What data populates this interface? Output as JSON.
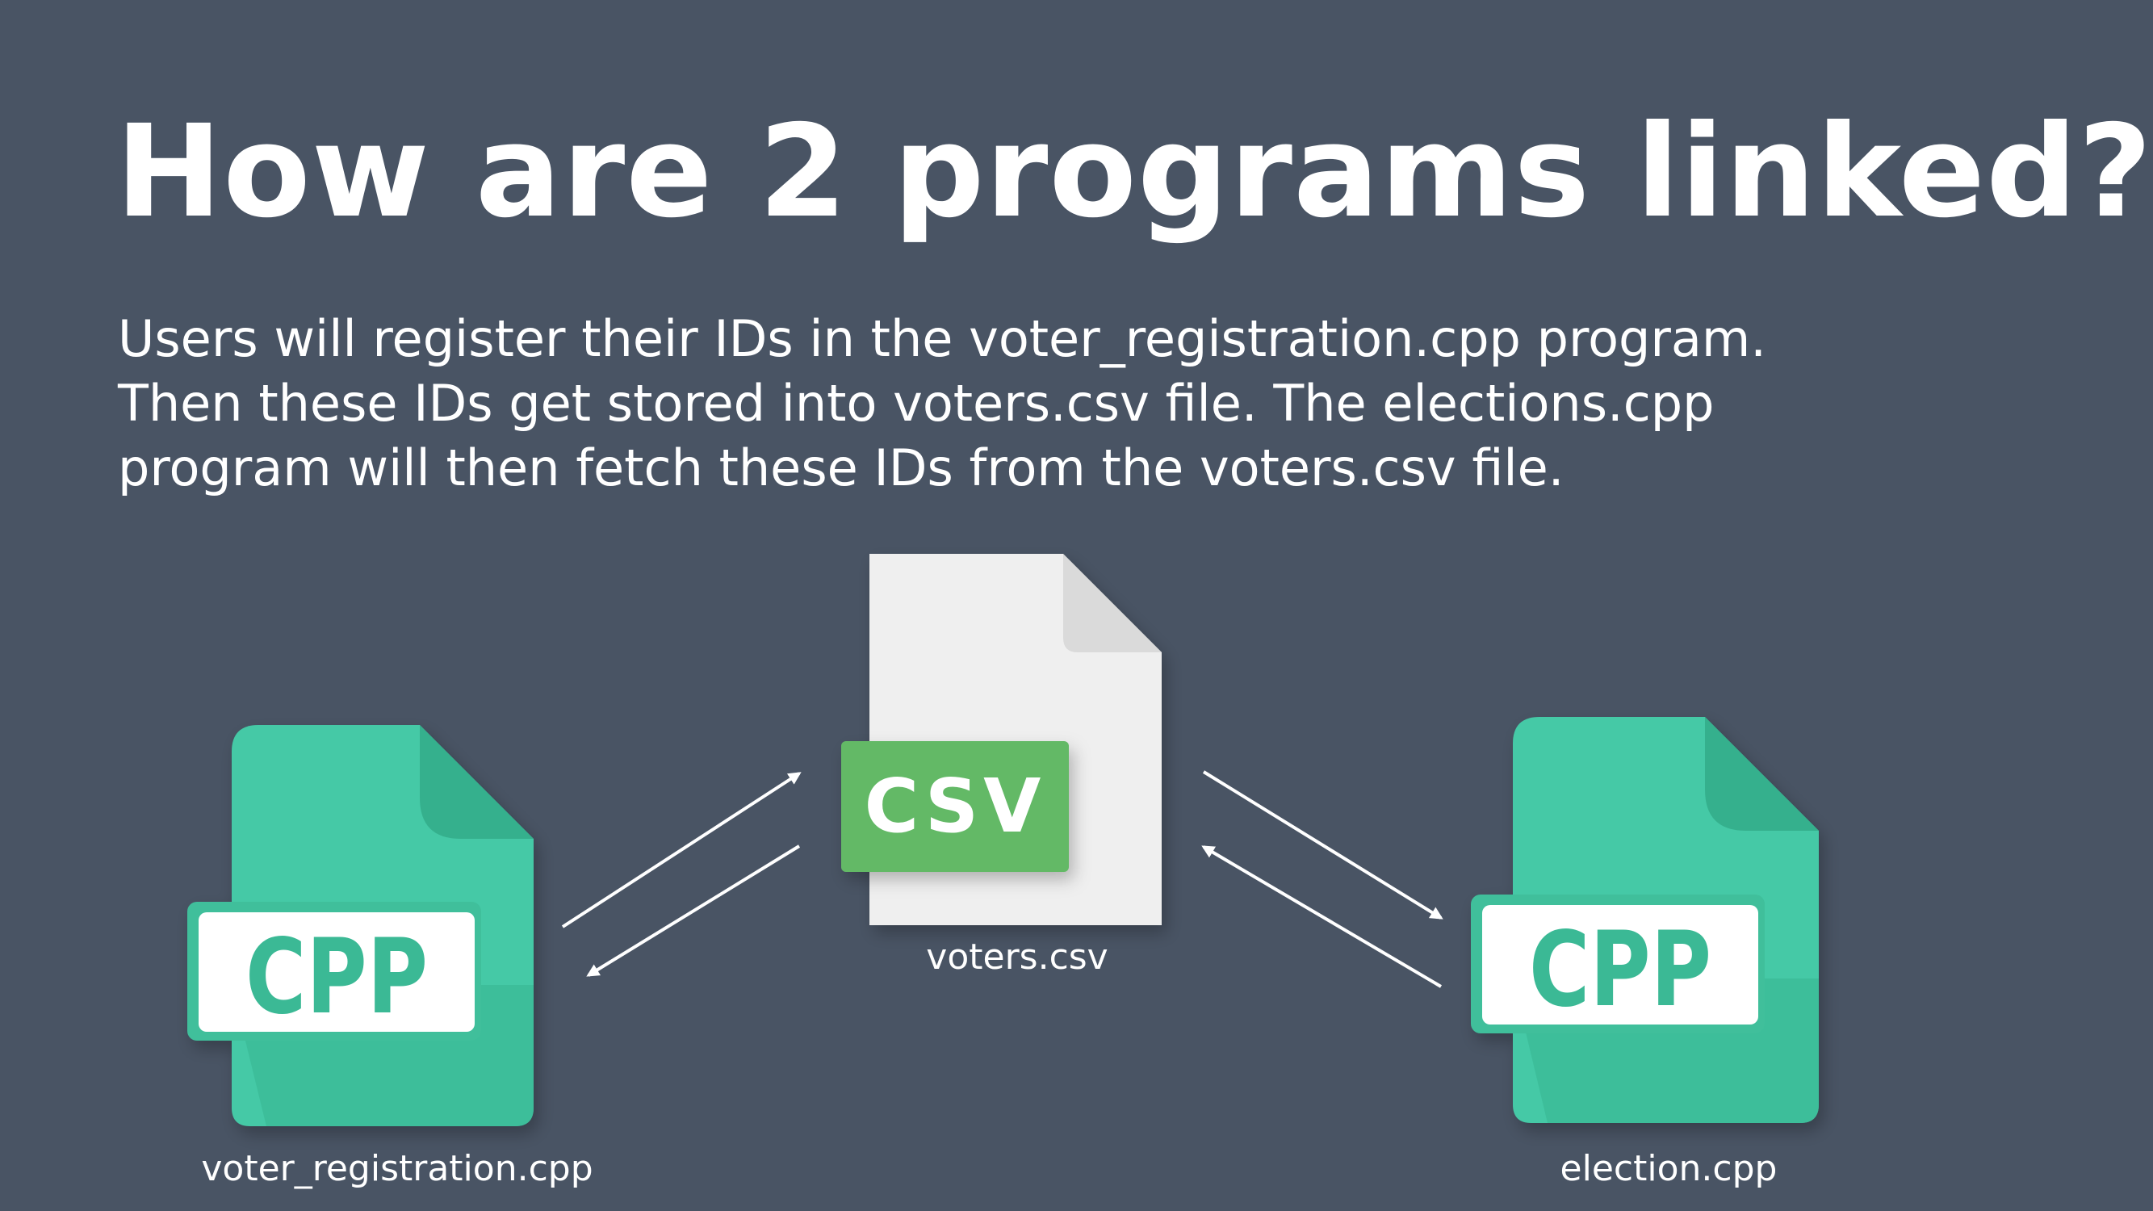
{
  "title": "How are 2 programs linked?",
  "description": {
    "line1": "Users will register their IDs in the voter_registration.cpp program.",
    "line2": "Then these IDs get stored into voters.csv file. The elections.cpp",
    "line3": "program will then fetch these IDs from the voters.csv file."
  },
  "nodes": {
    "left": {
      "badge": "CPP",
      "filename": "voter_registration.cpp",
      "icon": "cpp-file-icon",
      "color": "#44c9a6"
    },
    "center": {
      "badge": "CSV",
      "filename": "voters.csv",
      "icon": "csv-file-icon",
      "color": "#63b966"
    },
    "right": {
      "badge": "CPP",
      "filename": "election.cpp",
      "icon": "cpp-file-icon",
      "color": "#44c9a6"
    }
  },
  "colors": {
    "background": "#495464",
    "text": "#ffffff",
    "page": "#efefef"
  }
}
